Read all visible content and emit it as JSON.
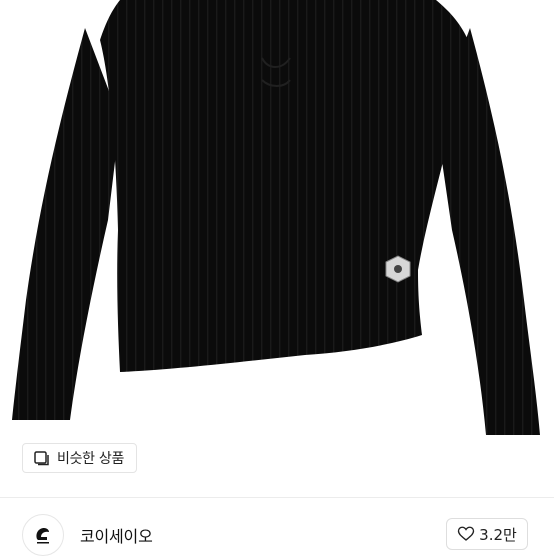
{
  "product": {
    "similar_button_label": "비슷한 상품",
    "garment_color": "#0b0b0b"
  },
  "shop": {
    "name": "코이세이오",
    "avatar_icon": "shop-logo-icon"
  },
  "like": {
    "count_label": "3.2만",
    "icon": "heart-outline-icon"
  },
  "colors": {
    "background": "#ffffff",
    "text": "#111111",
    "border": "#dedede"
  }
}
